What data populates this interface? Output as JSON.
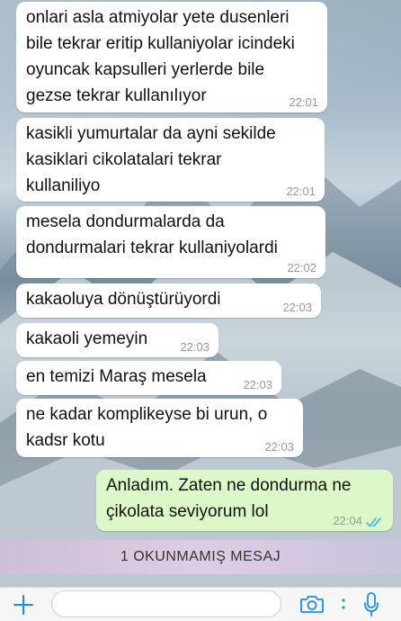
{
  "messages": [
    {
      "text": "onlari asla atmiyolar yete dusenleri\nbile tekrar eritip kullaniyolar icindeki\noyuncak kapsulleri yerlerde bile\ngezse tekrar kullanılıyor",
      "time": "22:01",
      "direction": "incoming"
    },
    {
      "text": "kasikli yumurtalar da ayni sekilde\nkasiklari cikolatalari tekrar\nkullaniliyo",
      "time": "22:01",
      "direction": "incoming"
    },
    {
      "text": "mesela dondurmalarda da\ndondurmalari tekrar kullaniyolardi",
      "time": "22:02",
      "direction": "incoming"
    },
    {
      "text": "kakaoluya dönüştürüyordi",
      "time": "22:03",
      "direction": "incoming"
    },
    {
      "text": "kakaoli yemeyin",
      "time": "22:03",
      "direction": "incoming"
    },
    {
      "text": "en temizi Maraş mesela",
      "time": "22:03",
      "direction": "incoming"
    },
    {
      "text": "ne kadar komplikeyse bi urun, o\nkadsr kotu",
      "time": "22:03",
      "direction": "incoming"
    },
    {
      "text": "Anladım. Zaten ne dondurma ne\nçikolata seviyorum lol",
      "time": "22:04",
      "direction": "outgoing",
      "status": "read"
    }
  ],
  "unread_banner": "1 OKUNMAMIŞ MESAJ",
  "input": {
    "placeholder": ""
  },
  "icons": {
    "attach": "plus-icon",
    "camera": "camera-icon",
    "more": "vertical-dots-icon",
    "voice": "microphone-icon",
    "read_receipt": "double-check-icon"
  },
  "colors": {
    "accent": "#1b8df2",
    "incoming_bubble": "#ffffff",
    "outgoing_bubble": "#dcf8c6",
    "read_tick": "#4fb6ec"
  }
}
